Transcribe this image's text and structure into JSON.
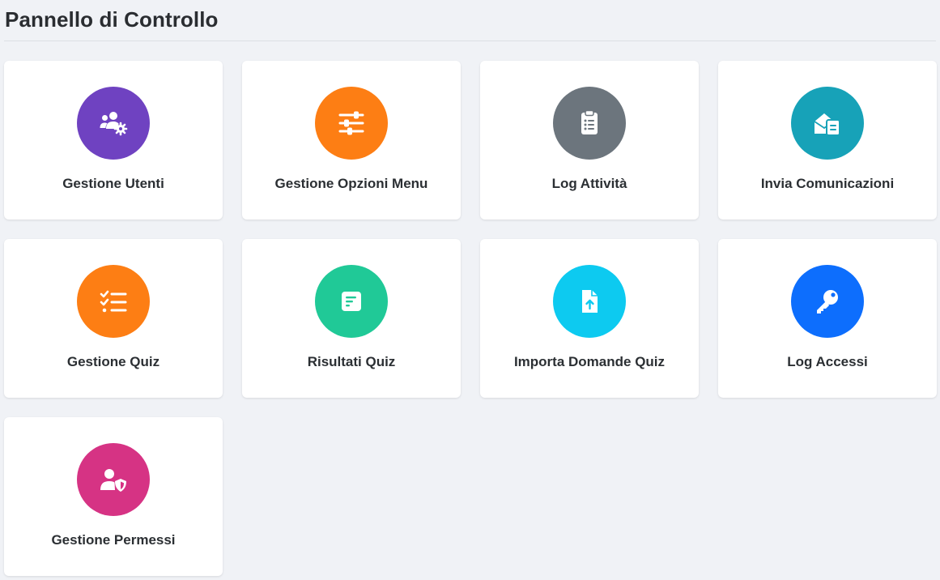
{
  "page": {
    "title": "Pannello di Controllo"
  },
  "cards": [
    {
      "label": "Gestione Utenti",
      "icon": "users-cog-icon",
      "color": "#6f42c1"
    },
    {
      "label": "Gestione Opzioni Menu",
      "icon": "sliders-icon",
      "color": "#fd7e14"
    },
    {
      "label": "Log Attività",
      "icon": "clipboard-list-icon",
      "color": "#6c757d"
    },
    {
      "label": "Invia Comunicazioni",
      "icon": "envelope-open-text-icon",
      "color": "#17a2b8"
    },
    {
      "label": "Gestione Quiz",
      "icon": "tasks-icon",
      "color": "#fd7e14"
    },
    {
      "label": "Risultati Quiz",
      "icon": "poll-h-icon",
      "color": "#20c997"
    },
    {
      "label": "Importa Domande Quiz",
      "icon": "file-upload-icon",
      "color": "#0dcaf0"
    },
    {
      "label": "Log Accessi",
      "icon": "key-icon",
      "color": "#0d6efd"
    },
    {
      "label": "Gestione Permessi",
      "icon": "user-shield-icon",
      "color": "#d63384"
    }
  ]
}
